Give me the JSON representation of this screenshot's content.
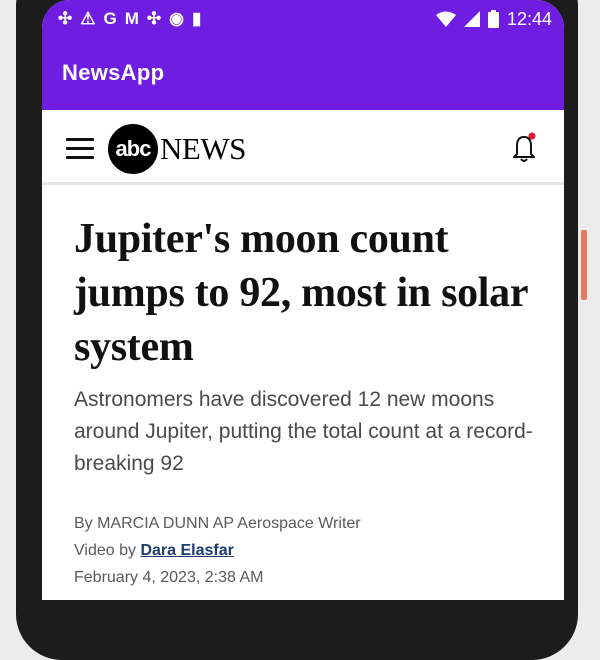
{
  "status_bar": {
    "time": "12:44",
    "left_icons": [
      "pinwheel-icon",
      "warning-triangle-icon",
      "google-g-icon",
      "gmail-icon",
      "pinwheel-icon",
      "record-circle-icon",
      "sd-card-icon"
    ],
    "right_icons": [
      "wifi-icon",
      "signal-icon",
      "battery-icon"
    ]
  },
  "app_bar": {
    "title": "NewsApp",
    "color": "#6f1de0"
  },
  "news_header": {
    "logo_abc": "abc",
    "logo_news": "NEWS",
    "notification_dot_color": "#e0162b"
  },
  "article": {
    "headline": "Jupiter's moon count jumps to 92, most in solar system",
    "subhead": "Astronomers have discovered 12 new moons around Jupiter, putting the total count at a record-breaking 92",
    "byline": "By MARCIA DUNN AP Aerospace Writer",
    "video_prefix": "Video by",
    "video_author": "Dara Elasfar",
    "date": "February 4, 2023, 2:38 AM"
  }
}
